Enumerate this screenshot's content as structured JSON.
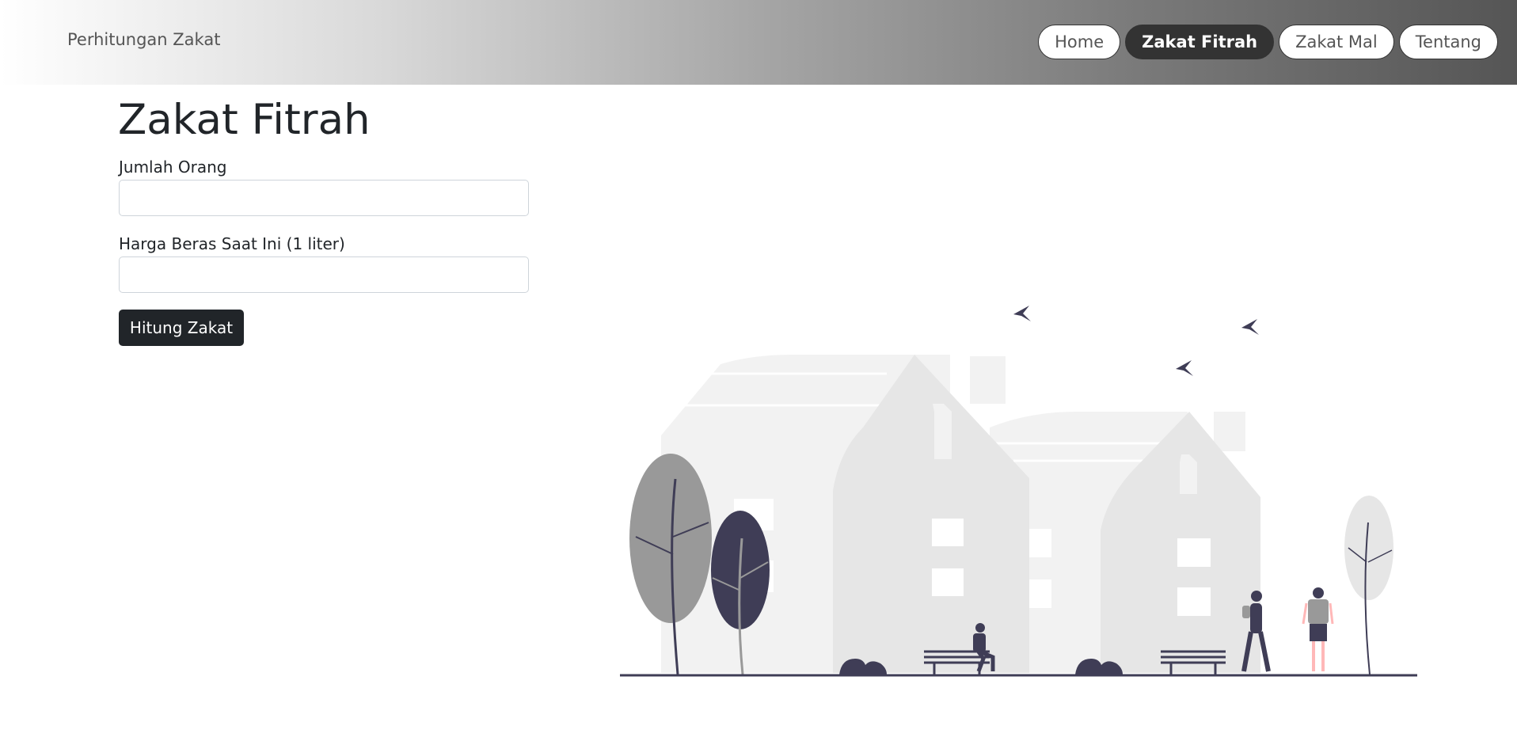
{
  "navbar": {
    "brand": "Perhitungan Zakat",
    "items": [
      {
        "label": "Home",
        "active": false
      },
      {
        "label": "Zakat Fitrah",
        "active": true
      },
      {
        "label": "Zakat Mal",
        "active": false
      },
      {
        "label": "Tentang",
        "active": false
      }
    ]
  },
  "main": {
    "title": "Zakat Fitrah",
    "fields": [
      {
        "label": "Jumlah Orang",
        "value": "",
        "placeholder": ""
      },
      {
        "label": "Harga Beras Saat Ini (1 liter)",
        "value": "",
        "placeholder": ""
      }
    ],
    "submit_label": "Hitung Zakat"
  },
  "colors": {
    "accent_dark": "#212529",
    "nav_active": "#333333",
    "illustration_dark": "#3f3d56",
    "illustration_light": "#e6e6e6"
  }
}
